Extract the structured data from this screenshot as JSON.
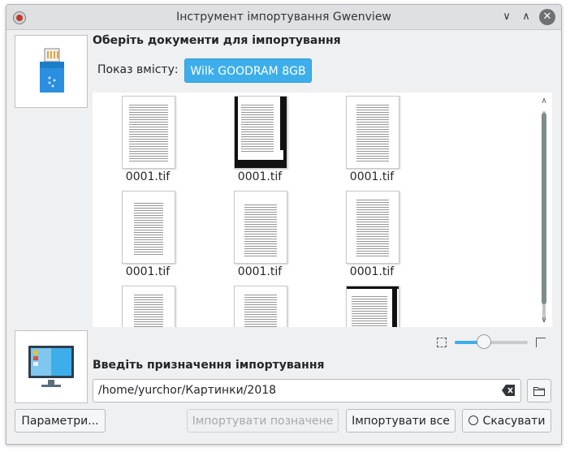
{
  "window": {
    "title": "Інструмент імпортування Gwenview"
  },
  "source_section": {
    "heading": "Оберіть документи для імпортування",
    "show_content_label": "Показ вмісту:",
    "device_button_label": "Wilk GOODRAM 8GB",
    "device_icon": "usb-drive-icon"
  },
  "gallery": {
    "items": [
      {
        "caption": "0001.tif"
      },
      {
        "caption": "0001.tif"
      },
      {
        "caption": "0001.tif"
      },
      {
        "caption": "0001.tif"
      },
      {
        "caption": "0001.tif"
      },
      {
        "caption": "0001.tif"
      }
    ],
    "zoom_level": 0.4
  },
  "destination_section": {
    "heading": "Введіть призначення імпортування",
    "path_value": "/home/yurchor/Картинки/2018",
    "destination_icon": "computer-monitor-icon"
  },
  "buttons": {
    "settings_label": "Параметри...",
    "import_selected_label": "Імпортувати позначене",
    "import_all_label": "Імпортувати все",
    "cancel_label": "Скасувати"
  },
  "colors": {
    "accent": "#3daee9",
    "window_bg": "#eff0f1"
  }
}
